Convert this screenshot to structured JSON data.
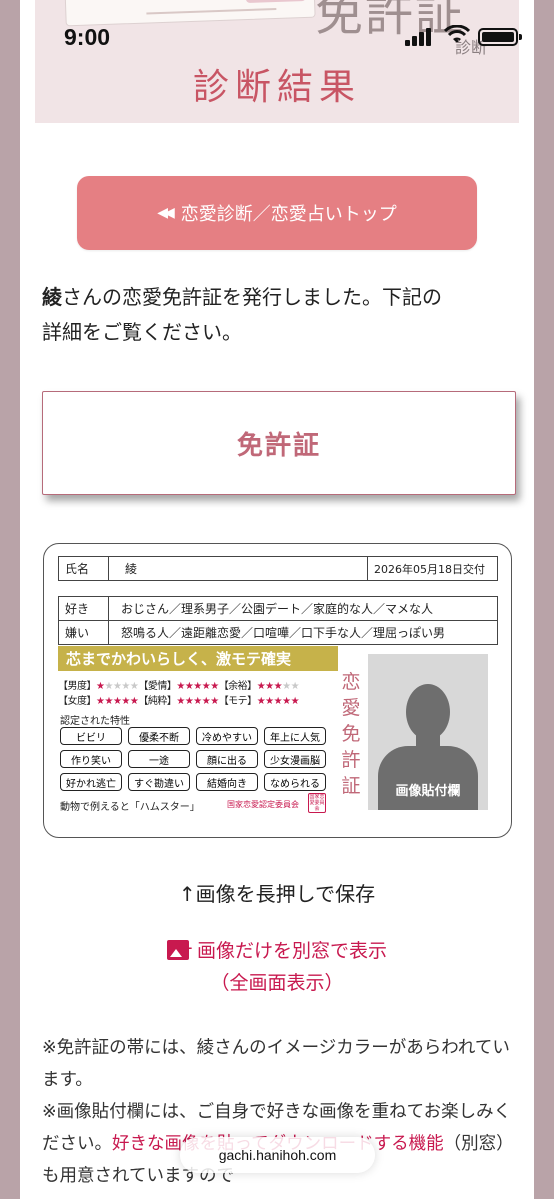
{
  "status_bar": {
    "time": "9:00"
  },
  "banner": {
    "title": "診断結果",
    "big_text": "免許証",
    "ghost_text": "診断"
  },
  "top_button": {
    "icon": "double-left-arrow-icon",
    "label": "恋愛診断／恋愛占いトップ"
  },
  "lead": {
    "name": "綾",
    "line1": "さんの恋愛免許証を発行しました。下記の",
    "line2": "詳細をご覧ください。"
  },
  "license_title": "免許証",
  "card": {
    "name_label": "氏名",
    "name_value": "綾",
    "issued": "2026年05月18日交付",
    "likes_label": "好き",
    "likes": "おじさん／理系男子／公園デート／家庭的な人／マメな人",
    "dislikes_label": "嫌い",
    "dislikes": "怒鳴る人／遠距離恋愛／口喧嘩／口下手な人／理屈っぽい男",
    "motto": "芯までかわいらしく、激モテ確実",
    "ratings": [
      {
        "label": "【男度】",
        "stars": 1
      },
      {
        "label": "【愛情】",
        "stars": 5
      },
      {
        "label": "【余裕】",
        "stars": 3
      },
      {
        "label": "【女度】",
        "stars": 5
      },
      {
        "label": "【純粋】",
        "stars": 5
      },
      {
        "label": "【モテ】",
        "stars": 5
      }
    ],
    "traits_label": "認定された特性",
    "traits": [
      "ビビリ",
      "優柔不断",
      "冷めやすい",
      "年上に人気",
      "作り笑い",
      "一途",
      "顔に出る",
      "少女漫画脳",
      "好かれ逃亡",
      "すぐ勘違い",
      "結婚向き",
      "なめられる"
    ],
    "animal": "動物で例えると「ハムスター」",
    "committee": "国家恋愛認定委員会",
    "seal": "国家恋愛委員会",
    "vertical_title": "恋愛免許証",
    "photo_label": "画像貼付欄"
  },
  "save_note": "↑画像を長押しで保存",
  "open_link": {
    "line1": "画像だけを別窓で表示",
    "line2": "（全画面表示）"
  },
  "notes": {
    "p1": "※免許証の帯には、綾さんのイメージカラーがあらわれています。",
    "p2_a": "※画像貼付欄には、ご自身で好きな画像を重ねてお楽しみください。",
    "p2_b": "好きな画像を貼ってダウンロードする機能",
    "p2_c": "（別窓）も用意されていますので"
  },
  "url_pill": "gachi.hanihoh.com"
}
